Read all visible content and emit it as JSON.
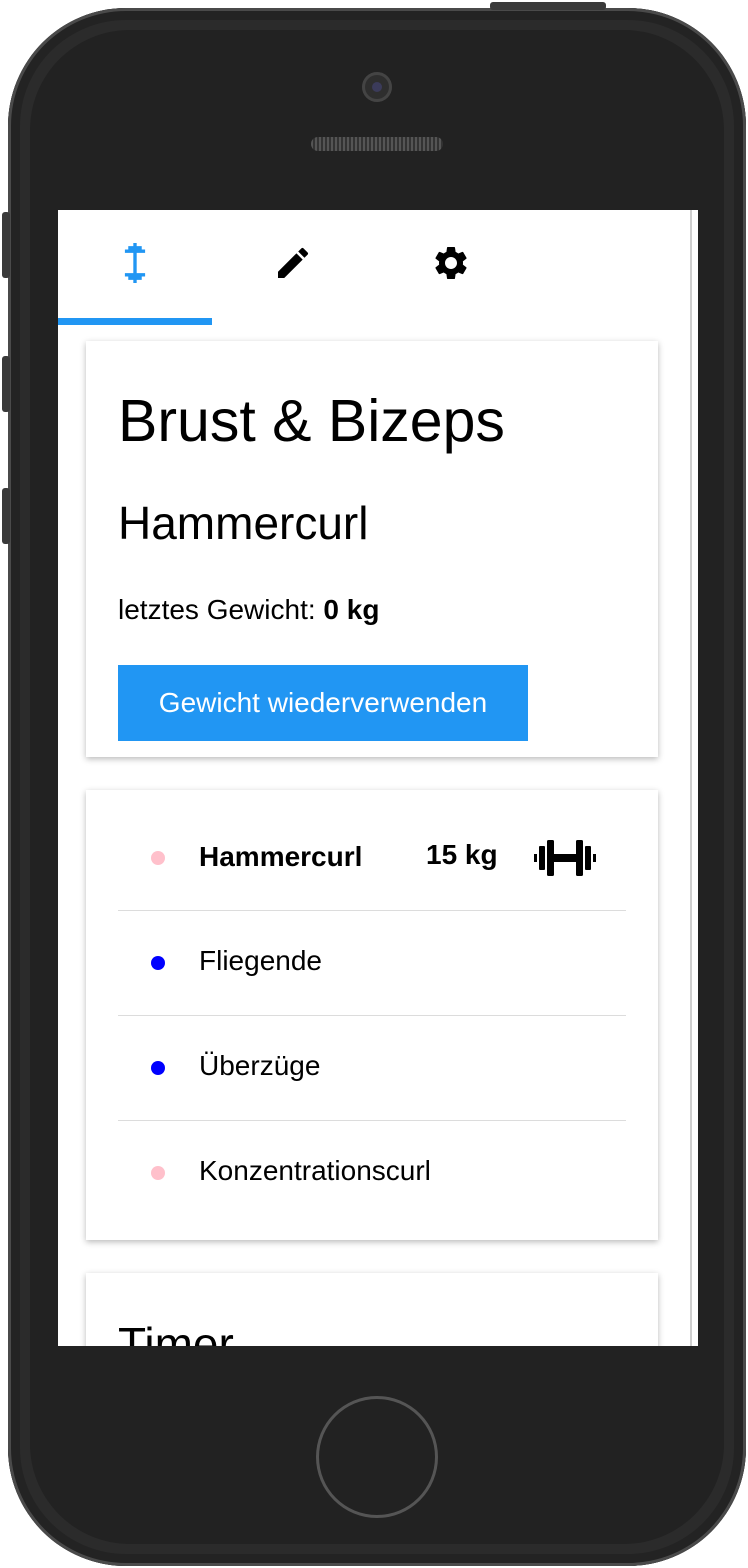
{
  "tabs": [
    {
      "icon": "dumbbell-icon",
      "active": true
    },
    {
      "icon": "pencil-icon",
      "active": false
    },
    {
      "icon": "gear-icon",
      "active": false
    }
  ],
  "workout": {
    "title": "Brust & Bizeps",
    "exercise": "Hammercurl",
    "last_weight_label": "letztes Gewicht:",
    "last_weight_value": "0 kg",
    "reuse_button": "Gewicht wiederverwenden"
  },
  "exercises": [
    {
      "name": "Hammercurl",
      "weight": "15 kg",
      "dot_color": "#ffc0cb",
      "active": true
    },
    {
      "name": "Fliegende",
      "weight": "",
      "dot_color": "#0000ff",
      "active": false
    },
    {
      "name": "Überzüge",
      "weight": "",
      "dot_color": "#0000ff",
      "active": false
    },
    {
      "name": "Konzentrationscurl",
      "weight": "",
      "dot_color": "#ffc0cb",
      "active": false
    }
  ],
  "timer": {
    "title": "Timer"
  },
  "colors": {
    "accent": "#2196F3"
  }
}
